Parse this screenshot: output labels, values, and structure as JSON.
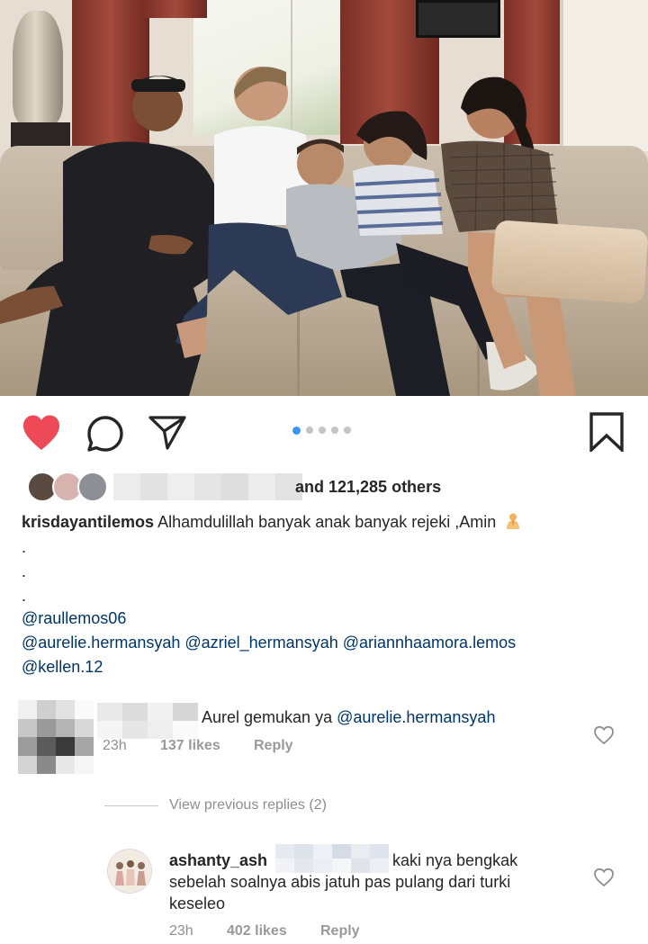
{
  "post": {
    "image": {
      "description_icon": "photo-icon"
    },
    "carousel": {
      "count": 5,
      "active_index": 0
    },
    "likes": {
      "text": "and 121,285 others"
    },
    "caption": {
      "username": "krisdayantilemos",
      "text": "Alhamdulillah banyak anak banyak rejeki ,Amin",
      "emoji": "praying-person-emoji",
      "dots": [
        ".",
        ".",
        "."
      ],
      "mention_line_1": "@raullemos06",
      "mention_line_2": "@aurelie.hermansyah @azriel_hermansyah @ariannhaamora.lemos",
      "mention_line_3": "@kellen.12"
    }
  },
  "comments": [
    {
      "text": "Aurel gemukan ya ",
      "mention": "@aurelie.hermansyah",
      "time": "23h",
      "likes": "137 likes",
      "reply_label": "Reply"
    }
  ],
  "view_previous": "View previous replies (2)",
  "reply": {
    "username": "ashanty_ash",
    "text_line_1": "kaki nya bengkak",
    "text_line_2": "sebelah soalnya abis jatuh pas pulang dari turki",
    "text_line_3": "keseleo",
    "time": "23h",
    "likes": "402 likes",
    "reply_label": "Reply"
  },
  "colors": {
    "heart_active": "#ed4956",
    "mention": "#003569",
    "meta": "#8e8e8e",
    "carousel_active": "#3897f0"
  }
}
